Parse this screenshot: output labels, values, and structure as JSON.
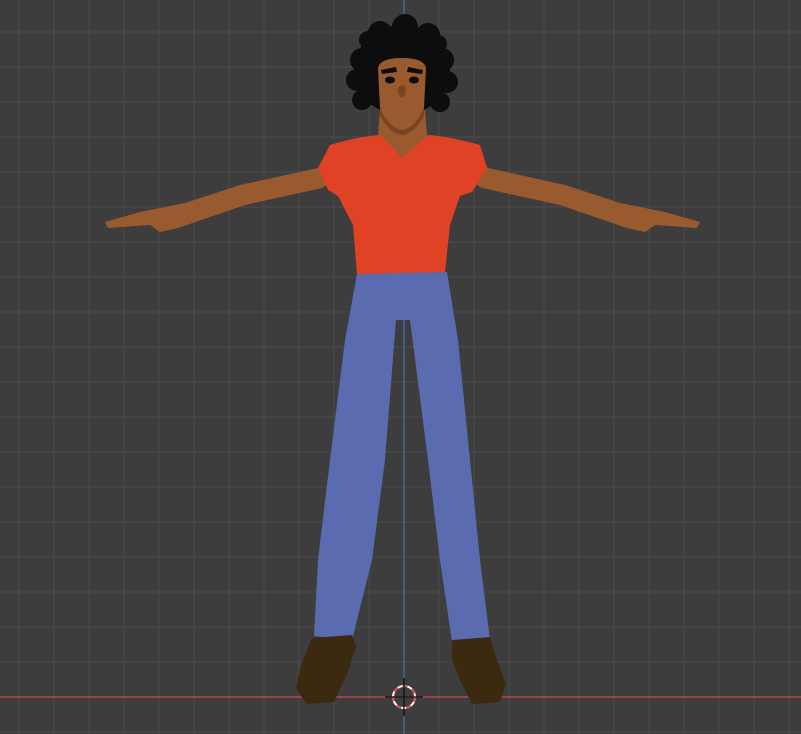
{
  "viewport": {
    "mode": "front-orthographic",
    "grid_visible": true,
    "colors": {
      "background": "#3d3d3d",
      "grid_line": "#4a4a4a",
      "axis_x": "#b8444e",
      "axis_z": "#3d7fd0",
      "cursor_ring": "#ffffff",
      "cursor_dash": "#d94c4c"
    }
  },
  "character": {
    "pose": "T-pose",
    "colors": {
      "skin": "#9a5a2f",
      "skin_shadow": "#7a4420",
      "hair": "#0d0d0d",
      "shirt": "#df4224",
      "pants": "#5a6bb0",
      "shoes": "#3b2a10"
    }
  },
  "cursor": {
    "icon": "3d-cursor-icon"
  }
}
